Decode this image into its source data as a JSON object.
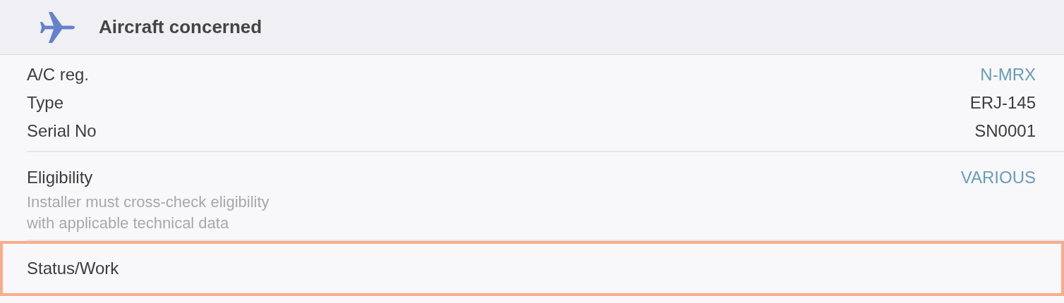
{
  "header": {
    "title": "Aircraft concerned"
  },
  "details": [
    {
      "label": "A/C reg.",
      "value": "N-MRX",
      "kind": "link"
    },
    {
      "label": "Type",
      "value": "ERJ-145",
      "kind": "plain"
    },
    {
      "label": "Serial No",
      "value": "SN0001",
      "kind": "plain"
    }
  ],
  "eligibility": {
    "label": "Eligibility",
    "value": "VARIOUS",
    "kind": "link",
    "note": [
      "Installer must cross-check eligibility",
      "with applicable technical data"
    ]
  },
  "status": {
    "label": "Status/Work",
    "highlighted": true
  }
}
